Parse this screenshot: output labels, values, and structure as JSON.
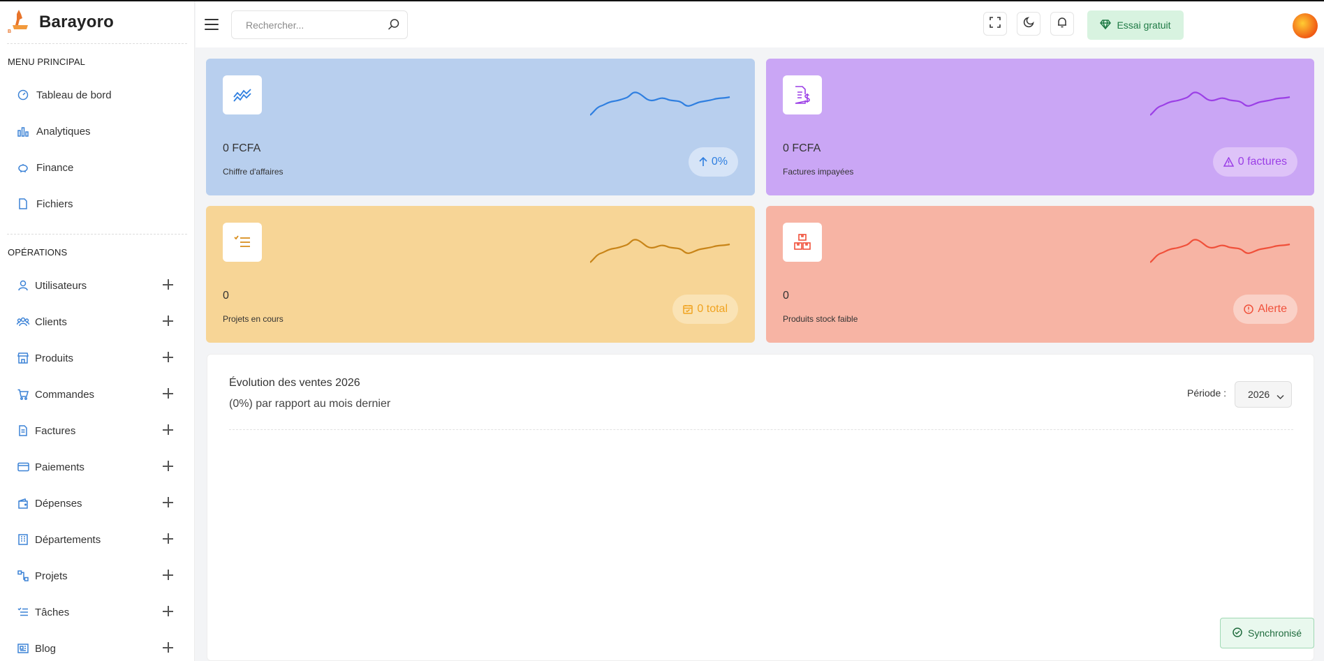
{
  "app": {
    "name": "Barayoro",
    "logo_text": "Barayoro"
  },
  "header": {
    "search_placeholder": "Rechercher...",
    "trial_label": "Essai gratuit",
    "icons": [
      "menu-icon",
      "search-icon",
      "diamond-icon",
      "fullscreen-icon",
      "moon-icon",
      "bell-icon"
    ]
  },
  "sidebar": {
    "main_title": "MENU PRINCIPAL",
    "main_items": [
      {
        "label": "Tableau de bord",
        "icon": "dashboard-icon"
      },
      {
        "label": "Analytiques",
        "icon": "bar-chart-icon"
      },
      {
        "label": "Finance",
        "icon": "piggy-bank-icon"
      },
      {
        "label": "Fichiers",
        "icon": "file-icon"
      }
    ],
    "ops_title": "OPÉRATIONS",
    "ops_items": [
      {
        "label": "Utilisateurs",
        "icon": "user-icon"
      },
      {
        "label": "Clients",
        "icon": "users-icon"
      },
      {
        "label": "Produits",
        "icon": "store-icon"
      },
      {
        "label": "Commandes",
        "icon": "cart-icon"
      },
      {
        "label": "Factures",
        "icon": "invoice-icon"
      },
      {
        "label": "Paiements",
        "icon": "credit-card-icon"
      },
      {
        "label": "Dépenses",
        "icon": "wallet-icon"
      },
      {
        "label": "Départements",
        "icon": "building-icon"
      },
      {
        "label": "Projets",
        "icon": "workflow-icon"
      },
      {
        "label": "Tâches",
        "icon": "checklist-icon"
      },
      {
        "label": "Blog",
        "icon": "news-icon"
      }
    ]
  },
  "cards": [
    {
      "value": "0 FCFA",
      "label": "Chiffre d'affaires",
      "badge": "0%",
      "icon": "trend-icon",
      "badge_icon": "arrow-up-icon",
      "color": "#2f7fe0"
    },
    {
      "value": "0 FCFA",
      "label": "Factures impayées",
      "badge": "0 factures",
      "icon": "invoice-dollar-icon",
      "badge_icon": "warning-icon",
      "color": "#9b3fe6"
    },
    {
      "value": "0",
      "label": "Projets en cours",
      "badge": "0 total",
      "icon": "task-list-icon",
      "badge_icon": "calendar-check-icon",
      "color": "#f0a320"
    },
    {
      "value": "0",
      "label": "Produits stock faible",
      "badge": "Alerte",
      "icon": "boxes-icon",
      "badge_icon": "alert-circle-icon",
      "color": "#f0503a"
    }
  ],
  "sales": {
    "title": "Évolution des ventes 2026",
    "subtitle": "(0%) par rapport au mois dernier",
    "period_label": "Période :",
    "period_value": "2026"
  },
  "toast": {
    "label": "Synchronisé",
    "icon": "check-circle-icon"
  }
}
